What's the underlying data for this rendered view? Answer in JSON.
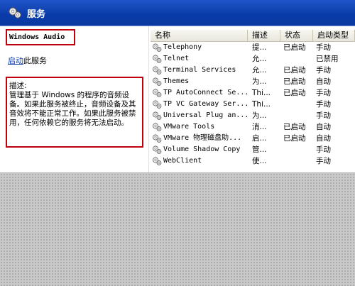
{
  "window": {
    "title": "服务",
    "icon": "gear-icon"
  },
  "left_pane": {
    "service_name": "Windows Audio",
    "start_link": "启动",
    "start_suffix": "此服务",
    "description_label": "描述:",
    "description_text": "管理基于 Windows 的程序的音频设备。如果此服务被终止，音频设备及其音效将不能正常工作。如果此服务被禁用，任何依赖它的服务将无法启动。"
  },
  "list": {
    "columns": {
      "name": "名称",
      "description": "描述",
      "status": "状态",
      "startup": "启动类型"
    },
    "rows": [
      {
        "name": "Telephony",
        "description": "提...",
        "status": "已启动",
        "startup": "手动"
      },
      {
        "name": "Telnet",
        "description": "允...",
        "status": "",
        "startup": "已禁用"
      },
      {
        "name": "Terminal Services",
        "description": "允...",
        "status": "已启动",
        "startup": "手动"
      },
      {
        "name": "Themes",
        "description": "为...",
        "status": "已启动",
        "startup": "自动"
      },
      {
        "name": "TP AutoConnect Se...",
        "description": "Thi...",
        "status": "已启动",
        "startup": "手动"
      },
      {
        "name": "TP VC Gateway Ser...",
        "description": "Thi...",
        "status": "",
        "startup": "手动"
      },
      {
        "name": "Universal Plug an...",
        "description": "为...",
        "status": "",
        "startup": "手动"
      },
      {
        "name": "VMware Tools",
        "description": "消...",
        "status": "已启动",
        "startup": "自动"
      },
      {
        "name": "VMware 物理磁盘助...",
        "description": "启...",
        "status": "已启动",
        "startup": "自动"
      },
      {
        "name": "Volume Shadow Copy",
        "description": "管...",
        "status": "",
        "startup": "手动"
      },
      {
        "name": "WebClient",
        "description": "使...",
        "status": "",
        "startup": "手动"
      }
    ]
  }
}
